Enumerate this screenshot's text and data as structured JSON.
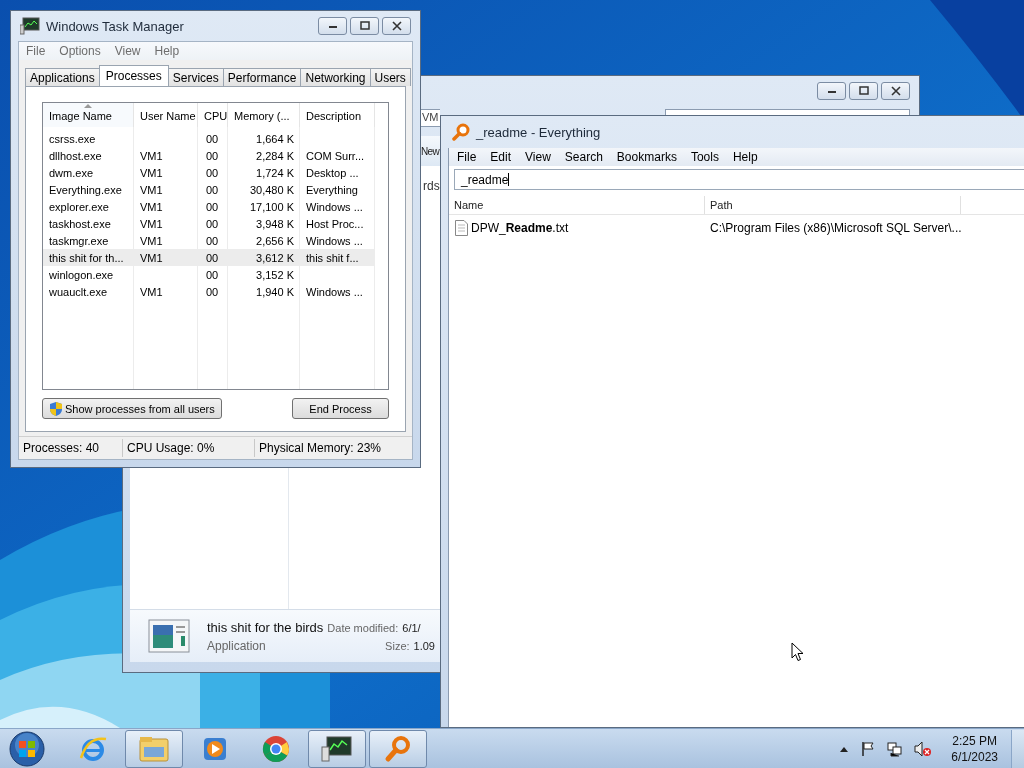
{
  "explorer_window": {
    "address_fragment": "VM",
    "toolbar_fragment": "New",
    "column_fragment": "rds",
    "details": {
      "name": "this shit for the birds",
      "type": "Application",
      "date_label": "Date modified:",
      "date_value": "6/1/",
      "size_label": "Size:",
      "size_value": "1.09"
    }
  },
  "task_manager": {
    "title": "Windows Task Manager",
    "menu": [
      "File",
      "Options",
      "View",
      "Help"
    ],
    "tabs": [
      {
        "label": "Applications",
        "selected": false
      },
      {
        "label": "Processes",
        "selected": true
      },
      {
        "label": "Services",
        "selected": false
      },
      {
        "label": "Performance",
        "selected": false
      },
      {
        "label": "Networking",
        "selected": false
      },
      {
        "label": "Users",
        "selected": false
      }
    ],
    "columns": [
      {
        "label": "Image Name",
        "sorted": true
      },
      {
        "label": "User Name",
        "sorted": false
      },
      {
        "label": "CPU",
        "sorted": false
      },
      {
        "label": "Memory (...",
        "sorted": false
      },
      {
        "label": "Description",
        "sorted": false
      }
    ],
    "rows": [
      {
        "image": "csrss.exe",
        "user": "",
        "cpu": "00",
        "memory": "1,664 K",
        "description": "",
        "selected": false
      },
      {
        "image": "dllhost.exe",
        "user": "VM1",
        "cpu": "00",
        "memory": "2,284 K",
        "description": "COM Surr...",
        "selected": false
      },
      {
        "image": "dwm.exe",
        "user": "VM1",
        "cpu": "00",
        "memory": "1,724 K",
        "description": "Desktop ...",
        "selected": false
      },
      {
        "image": "Everything.exe",
        "user": "VM1",
        "cpu": "00",
        "memory": "30,480 K",
        "description": "Everything",
        "selected": false
      },
      {
        "image": "explorer.exe",
        "user": "VM1",
        "cpu": "00",
        "memory": "17,100 K",
        "description": "Windows ...",
        "selected": false
      },
      {
        "image": "taskhost.exe",
        "user": "VM1",
        "cpu": "00",
        "memory": "3,948 K",
        "description": "Host Proc...",
        "selected": false
      },
      {
        "image": "taskmgr.exe",
        "user": "VM1",
        "cpu": "00",
        "memory": "2,656 K",
        "description": "Windows ...",
        "selected": false
      },
      {
        "image": "this shit for th...",
        "user": "VM1",
        "cpu": "00",
        "memory": "3,612 K",
        "description": "this shit f...",
        "selected": true
      },
      {
        "image": "winlogon.exe",
        "user": "",
        "cpu": "00",
        "memory": "3,152 K",
        "description": "",
        "selected": false
      },
      {
        "image": "wuauclt.exe",
        "user": "VM1",
        "cpu": "00",
        "memory": "1,940 K",
        "description": "Windows ...",
        "selected": false
      }
    ],
    "buttons": {
      "show_all": "Show processes from all users",
      "end": "End Process"
    },
    "status_bar": [
      "Processes: 40",
      "CPU Usage: 0%",
      "Physical Memory: 23%"
    ]
  },
  "everything": {
    "title": "_readme - Everything",
    "menu": [
      "File",
      "Edit",
      "View",
      "Search",
      "Bookmarks",
      "Tools",
      "Help"
    ],
    "search": {
      "value": "_readme"
    },
    "columns": [
      "Name",
      "Path"
    ],
    "results": [
      {
        "name": "DPW_**Readme**.txt",
        "path": "C:\\Program Files (x86)\\Microsoft SQL Server\\..."
      }
    ]
  },
  "taskbar": {
    "apps": [
      {
        "kind": "ie",
        "active": false
      },
      {
        "kind": "explorer",
        "active": true
      },
      {
        "kind": "media",
        "active": false
      },
      {
        "kind": "chrome",
        "active": false
      },
      {
        "kind": "taskmgr",
        "active": true
      },
      {
        "kind": "everything",
        "active": true
      }
    ],
    "clock": {
      "time": "2:25 PM",
      "date": "6/1/2023"
    }
  }
}
